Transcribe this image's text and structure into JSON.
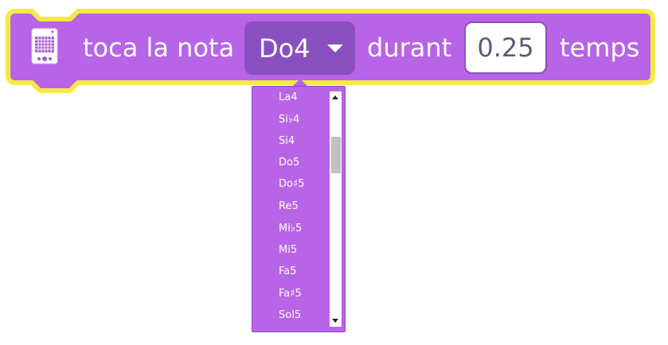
{
  "block": {
    "prefix_label": "toca la nota",
    "note_value": "Do4",
    "middle_label": "durant",
    "duration_value": "0.25",
    "suffix_label": "temps",
    "colors": {
      "block_fill": "#b764e6",
      "block_outline": "#f5ea43",
      "field_dark": "#8a4fbf",
      "number_text": "#575e75"
    }
  },
  "dropdown_menu": {
    "items": [
      "La4",
      "Si♭4",
      "Si4",
      "Do5",
      "Do♯5",
      "Re5",
      "Mi♭5",
      "Mi5",
      "Fa5",
      "Fa♯5",
      "Sol5"
    ]
  },
  "icons": {
    "device": "device-icon",
    "caret": "caret-down-icon"
  }
}
